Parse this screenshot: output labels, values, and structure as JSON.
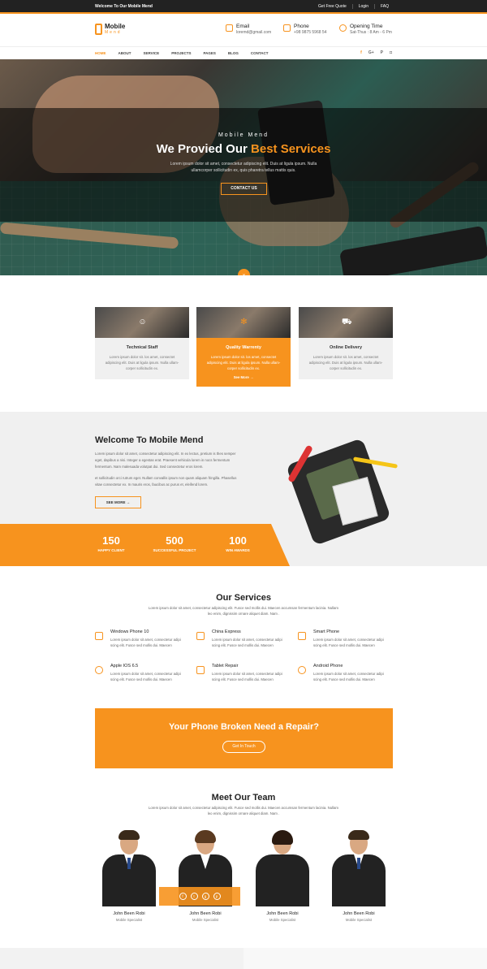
{
  "topbar": {
    "welcome": "Welcome To Our Mobile Mend",
    "links": [
      "Get Free Quote",
      "Login",
      "FAQ"
    ]
  },
  "brand": {
    "name": "Mobile",
    "sub": "Mend"
  },
  "contacts": [
    {
      "label": "Email",
      "value": "loremd@gmail.com",
      "icon": "mail-icon"
    },
    {
      "label": "Phone",
      "value": "+98 9875 5968 54",
      "icon": "phone-icon"
    },
    {
      "label": "Opening Time",
      "value": "Sat-Thus : 8 Am - 6 Pm",
      "icon": "clock-icon"
    }
  ],
  "nav": {
    "items": [
      "HOME",
      "ABOUT",
      "SERVICE",
      "PROJECTS",
      "PAGES",
      "BLOG",
      "CONTACT"
    ],
    "social": [
      "f",
      "G+",
      "P",
      "◘"
    ]
  },
  "hero": {
    "sub": "Mobile Mend",
    "title_a": "We Provied Our",
    "title_b": "Best Services",
    "desc": "Lorem ipsum dolor sit amet, consectetur adipiscing elit. Duis at ligula ipsum. Nulla ullamcorper sollicitudin ex, quis pharetra tellus mattis quis.",
    "cta": "CONTACT US",
    "scroll": "⌄"
  },
  "features": [
    {
      "title": "Technical Staff",
      "text": "Lorem ipsum dolor sit. los amet, consectet adipiscing elit. Duis at ligula ipsum. Nulla ullam-corper sollicitudin ex.",
      "icon": "staff-icon"
    },
    {
      "title": "Quality Warrenty",
      "text": "Lorem ipsum dolor sit. los amet, consectet adipiscing elit. Duis at ligula ipsum. Nulla ullam-corper sollicitudin ex.",
      "more": "See More →",
      "icon": "warranty-icon"
    },
    {
      "title": "Online Delivery",
      "text": "Lorem ipsum dolor sit. los amet, consectet adipiscing elit. Duis at ligula ipsum. Nulla ullam-corper sollicitudin ex.",
      "icon": "cart-icon"
    }
  ],
  "welcome": {
    "title": "Welcome To Mobile Mend",
    "p1": "Lorem ipsum dolor sit amet, consectetur adipiscing elit. In ex lectus, pretium is thes semper eget, dapibus a nisi. Integer a egestas erat. Praesent vehicula lorem in nocs fermentum fermentum. Nam malesuada volutpat dui. Sed consectetur eros lorem.",
    "p2": "et sollicitudin orci rutrum eget. Nullam convallis ipsum non quam aliquam fringilla. Phasellus vitae consectetur ex. In mauris eros, faucibus ac purus et, eleifend lorem.",
    "btn": "SEE MORE →"
  },
  "stats": [
    {
      "n": "150",
      "l": "HAPPY CLIENT"
    },
    {
      "n": "500",
      "l": "SUCCESSFUL PROJECT"
    },
    {
      "n": "100",
      "l": "WIN AWARDS"
    }
  ],
  "services": {
    "title": "Our Services",
    "desc": "Lorem ipsum dolor sit amet, consectetur adipiscing elit. Fusce sed mollis dui. Maecen accumsan fermentum lacinia. Nullam leo enim, dignissim ornare aliquet diam. Nam .",
    "items": [
      {
        "title": "Windows Phone 10",
        "text": "Lorem ipsum dolor sit amet, consectetur adipi scing elit. Fusce sed mollis dui. Maecen"
      },
      {
        "title": "China Express",
        "text": "Lorem ipsum dolor sit amet, consectetur adipi scing elit. Fusce sed mollis dui. Maecen"
      },
      {
        "title": "Smart Phone",
        "text": "Lorem ipsum dolor sit amet, consectetur adipi scing elit. Fusce sed mollis dui. Maecen"
      },
      {
        "title": "Apple IOS 6.5",
        "text": "Lorem ipsum dolor sit amet, consectetur adipi scing elit. Fusce sed mollis dui. Maecen"
      },
      {
        "title": "Tablet Repair",
        "text": "Lorem ipsum dolor sit amet, consectetur adipi scing elit. Fusce sed mollis dui. Maecen"
      },
      {
        "title": "Android Phone",
        "text": "Lorem ipsum dolor sit amet, consectetur adipi scing elit. Fusce sed mollis dui. Maecen"
      }
    ]
  },
  "repair": {
    "title": "Your Phone Broken Need a Repair?",
    "btn": "Get In Touch"
  },
  "team": {
    "title": "Meet Our Team",
    "desc": "Lorem ipsum dolor sit amet, consectetur adipiscing elit. Fusce sed mollis dui. Maecen accumsan fermentum lacinia. Nullam leo enim, dignissim ornare aliquet diam. Nam .",
    "members": [
      {
        "name": "John Been Robi",
        "role": "Mobile Specialist"
      },
      {
        "name": "John Been Robi",
        "role": "Mobile Specialist"
      },
      {
        "name": "John Been Robi",
        "role": "Mobile Specialist"
      },
      {
        "name": "John Been Robi",
        "role": "Mobile Specialist"
      }
    ],
    "social": [
      "f",
      "t",
      "g",
      "p"
    ]
  },
  "colors": {
    "accent": "#f7931e",
    "dark": "#222222",
    "light_bg": "#f0f0f0"
  }
}
